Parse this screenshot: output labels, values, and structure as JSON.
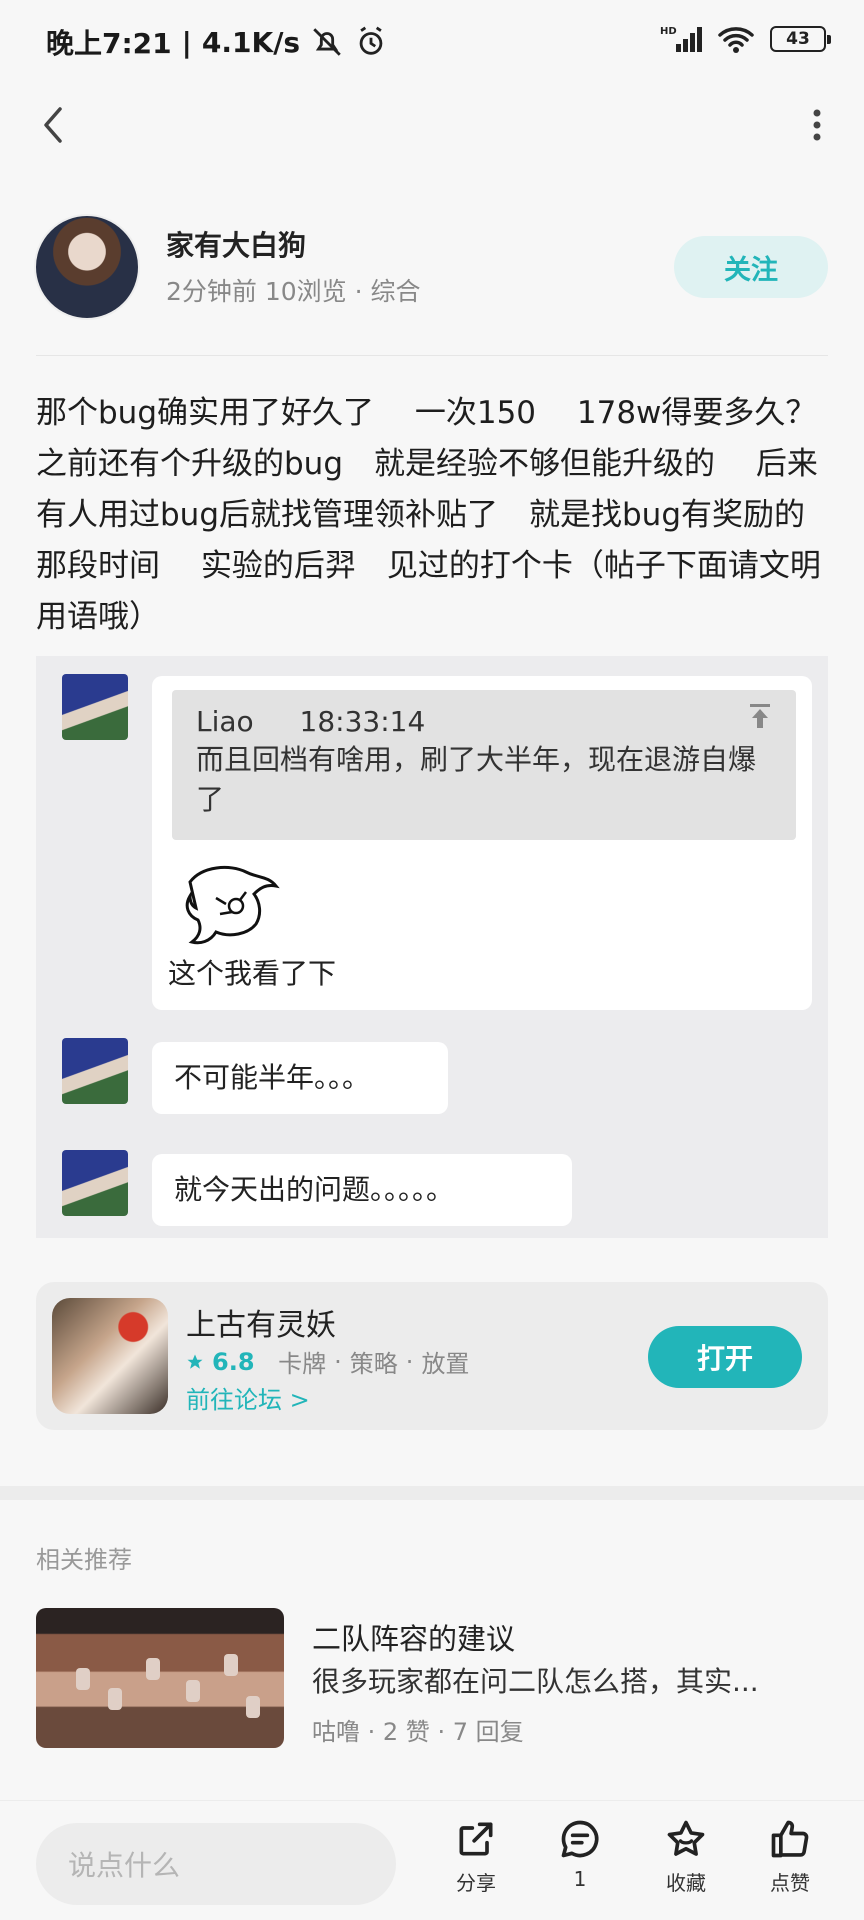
{
  "status_bar": {
    "time": "晚上7:21",
    "speed": "4.1K/s",
    "network": "HD",
    "battery": "43"
  },
  "nav": {
    "back_icon": "chevron-left-icon",
    "more_icon": "more-vertical-icon"
  },
  "author": {
    "name": "家有大白狗",
    "time": "2分钟前",
    "views": "10浏览",
    "category": "综合",
    "follow_label": "关注"
  },
  "post": {
    "text": "那个bug确实用了好久了　 一次150　 178w得要多久？　 之前还有个升级的bug　就是经验不够但能升级的　 后来有人用过bug后就找管理领补贴了　就是找bug有奖励的那段时间　 实验的后羿　见过的打个卡（帖子下面请文明用语哦）"
  },
  "screenshot": {
    "quote_user": "Liao",
    "quote_time": "18:33:14",
    "quote_text": "而且回档有啥用，刷了大半年，现在退游自爆了",
    "reply1": "这个我看了下",
    "reply2": "不可能半年。。。",
    "reply3": "就今天出的问题。。。。。"
  },
  "game": {
    "name": "上古有灵妖",
    "rating": "6.8",
    "tags": [
      "卡牌",
      "策略",
      "放置"
    ],
    "link": "前往论坛 >",
    "open_label": "打开"
  },
  "related": {
    "section_title": "相关推荐",
    "items": [
      {
        "title": "二队阵容的建议",
        "desc": "很多玩家都在问二队怎么搭，其实...",
        "author": "咕噜",
        "likes": "2 赞",
        "replies": "7 回复"
      }
    ]
  },
  "bottom": {
    "comment_placeholder": "说点什么",
    "share_label": "分享",
    "comment_count": "1",
    "favorite_label": "收藏",
    "like_label": "点赞"
  },
  "colors": {
    "accent": "#22b5b9",
    "follow_bg": "#dff2f2"
  }
}
